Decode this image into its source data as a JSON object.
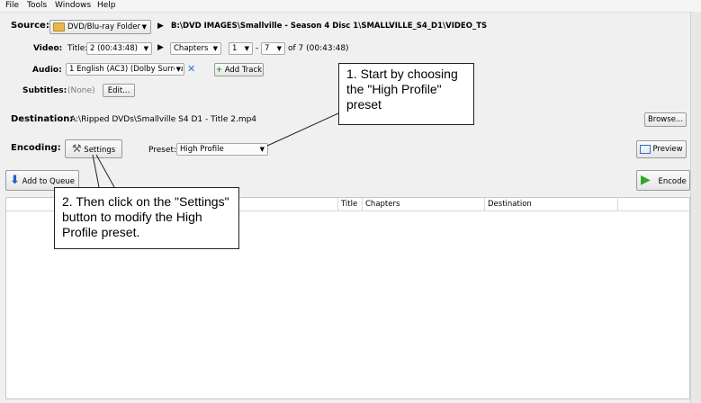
{
  "menu": [
    "File",
    "Tools",
    "Windows",
    "Help"
  ],
  "source": {
    "label": "Source:",
    "button": "DVD/Blu-ray Folder",
    "path": "B:\\DVD IMAGES\\Smallville - Season 4 Disc 1\\SMALLVILLE_S4_D1\\VIDEO_TS"
  },
  "video": {
    "label": "Video:",
    "title_label": "Title:",
    "title_value": "2 (00:43:48)",
    "range_type": "Chapters",
    "chapter_start": "1",
    "dash": "-",
    "chapter_end": "7",
    "of_text": "of 7 (00:43:48)"
  },
  "audio": {
    "label": "Audio:",
    "track": "1 English (AC3) (Dolby Surrou",
    "add_track": "Add Track"
  },
  "subtitles": {
    "label": "Subtitles:",
    "value": "(None)",
    "edit": "Edit..."
  },
  "destination": {
    "label": "Destination:",
    "path": "A:\\Ripped DVDs\\Smallville S4 D1 - Title 2.mp4",
    "browse": "Browse..."
  },
  "encoding": {
    "label": "Encoding:",
    "settings": "Settings",
    "preset_label": "Preset:",
    "preset_value": "High Profile",
    "preview": "Preview"
  },
  "actions": {
    "add_to_queue": "Add to Queue",
    "encode": "Encode"
  },
  "queue_columns": [
    "Title",
    "Chapters",
    "Destination"
  ],
  "callouts": {
    "one": "1. Start by choosing the \"High Profile\" preset",
    "two": "2. Then click on the \"Settings\" button to modify the High Profile preset."
  },
  "colors": {
    "encode_green": "#2aa82a",
    "queue_blue": "#2463c7",
    "add_track_green": "#1f9a1f",
    "remove_blue": "#2b6fd4"
  }
}
